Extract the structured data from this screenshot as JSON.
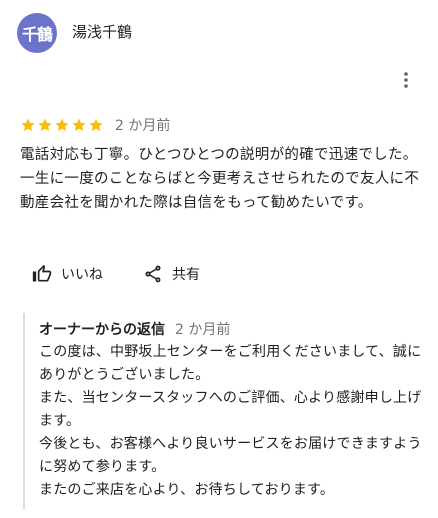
{
  "reviewer": {
    "avatar_text": "千鶴",
    "avatar_color": "#6b74c8",
    "name": "湯浅千鶴"
  },
  "menu": {
    "icon": "more-vert-icon"
  },
  "review": {
    "rating": 5,
    "rating_max": 5,
    "star_color": "#fbbc04",
    "date": "2 か月前",
    "text": "電話対応も丁寧。ひとつひとつの説明が的確で迅速でした。一生に一度のことならばと今更考えさせられたので友人に不動産会社を聞かれた際は自信をもって勧めたいです。"
  },
  "actions": {
    "like_label": "いいね",
    "like_icon": "thumb-up-icon",
    "share_label": "共有",
    "share_icon": "share-icon"
  },
  "owner_reply": {
    "title": "オーナーからの返信",
    "date": "2 か月前",
    "text": "この度は、中野坂上センターをご利用くださいまして、誠にありがとうございました。\nまた、当センタースタッフへのご評価、心より感謝申し上げます。\n今後とも、お客様へより良いサービスをお届けできますように努めて参ります。\nまたのご来店を心より、お待ちしております。"
  }
}
